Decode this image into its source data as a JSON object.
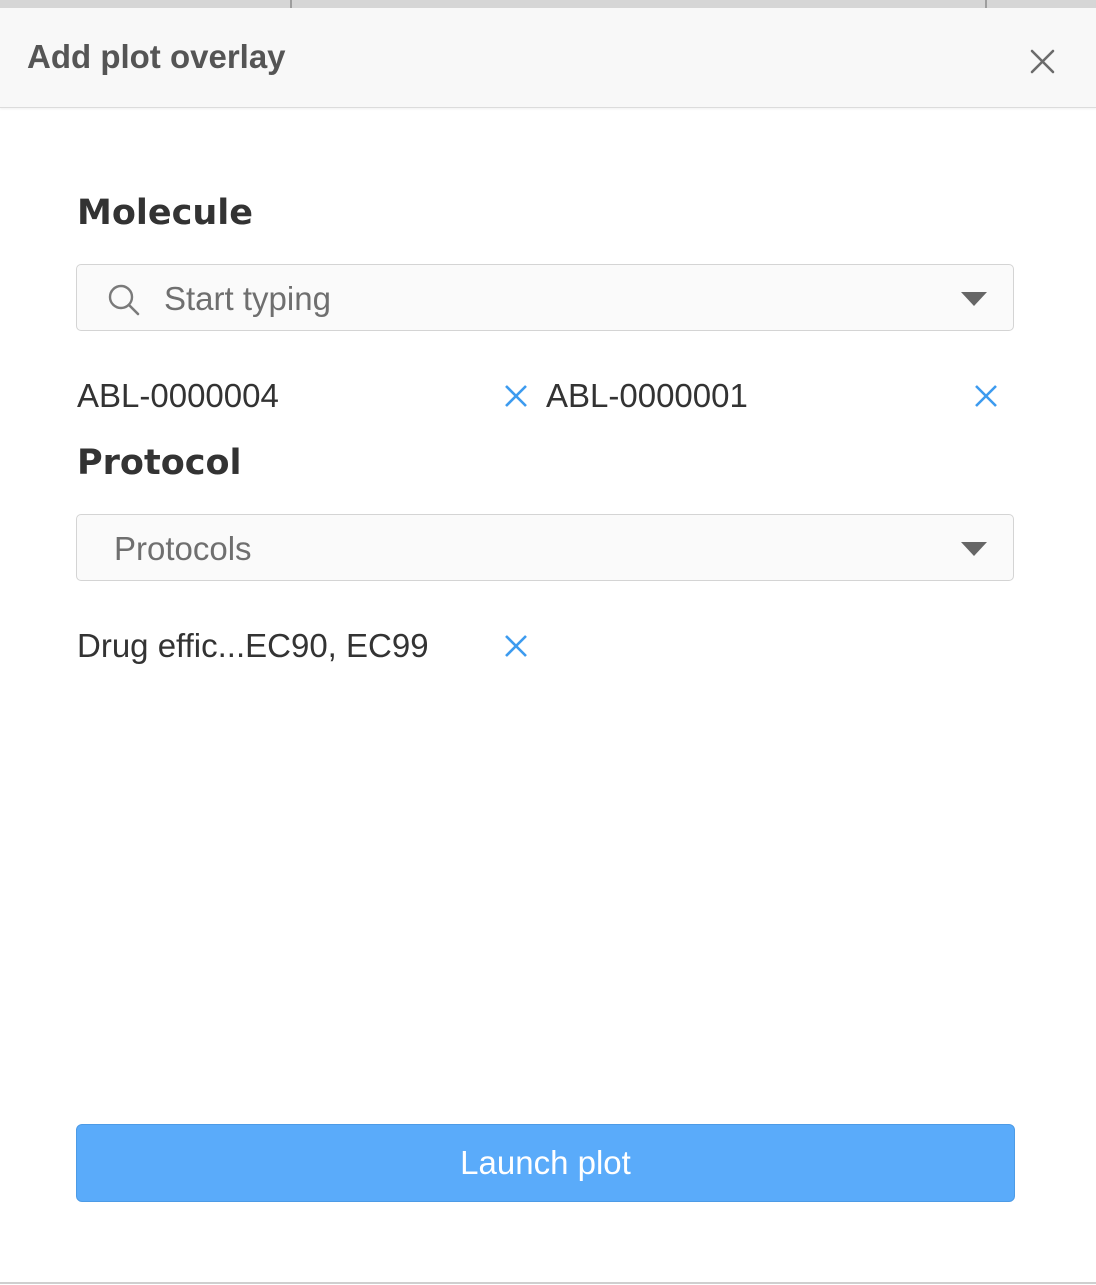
{
  "dialog": {
    "title": "Add plot overlay",
    "close_icon": "close-icon"
  },
  "molecule": {
    "label": "Molecule",
    "placeholder": "Start typing",
    "search_icon": "search-icon",
    "dropdown_icon": "caret-down-icon",
    "selected": [
      {
        "label": "ABL-0000004",
        "remove_icon": "remove-icon"
      },
      {
        "label": "ABL-0000001",
        "remove_icon": "remove-icon"
      }
    ]
  },
  "protocol": {
    "label": "Protocol",
    "placeholder": "Protocols",
    "dropdown_icon": "caret-down-icon",
    "selected": [
      {
        "label": "Drug effic...EC90, EC99",
        "remove_icon": "remove-icon"
      }
    ]
  },
  "actions": {
    "launch_label": "Launch plot"
  },
  "colors": {
    "accent": "#5aabfa",
    "remove_icon": "#3d9bef",
    "title_text": "#555555",
    "label_text": "#333333"
  }
}
